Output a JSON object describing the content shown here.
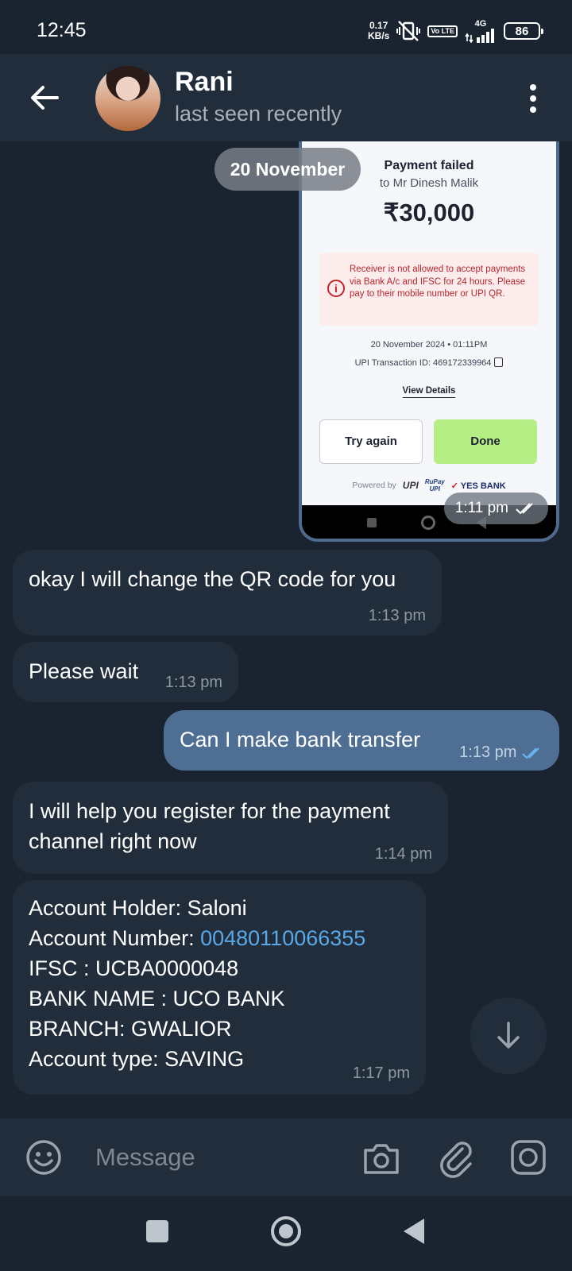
{
  "status_bar": {
    "time": "12:45",
    "net_speed_value": "0.17",
    "net_speed_unit": "KB/s",
    "volte": "Vo LTE",
    "network": "4G",
    "battery": "86"
  },
  "header": {
    "name": "Rani",
    "status": "last seen recently"
  },
  "date_chip": "20 November",
  "payment_screenshot": {
    "title": "Payment failed",
    "to": "to Mr Dinesh Malik",
    "amount": "₹30,000",
    "alert": "Receiver is not allowed to accept payments via Bank A/c and IFSC for 24 hours. Please pay to their mobile number or UPI QR.",
    "alert_icon": "i",
    "date": "20 November 2024 • 01:11PM",
    "txn": "UPI Transaction ID: 469172339964",
    "view_details": "View Details",
    "try_again": "Try again",
    "done": "Done",
    "powered_by": "Powered by",
    "upi": "UPI",
    "rupay_top": "RuPay",
    "rupay_bottom": "UPI",
    "yes_mark": "✓",
    "yes_bank": "YES BANK",
    "time": "1:11 pm"
  },
  "messages": [
    {
      "direction": "in",
      "text": "okay I will change the QR code for you",
      "time": "1:13 pm"
    },
    {
      "direction": "in",
      "text": "Please wait",
      "time": "1:13 pm"
    },
    {
      "direction": "out",
      "text": "Can I make bank transfer",
      "time": "1:13 pm"
    },
    {
      "direction": "in",
      "line1": "I will help you register for the payment",
      "line2": "channel right now",
      "time": "1:14 pm"
    },
    {
      "direction": "in",
      "lines": {
        "holder": "Account Holder: Saloni",
        "number_label": "Account Number: ",
        "number": "00480110066355",
        "ifsc": "IFSC : UCBA0000048",
        "bank": "BANK NAME : UCO BANK",
        "branch": "BRANCH: GWALIOR",
        "type": "Account type: SAVING"
      },
      "time": "1:17 pm"
    }
  ],
  "input": {
    "placeholder": "Message"
  },
  "colors": {
    "background": "#1a2330",
    "header": "#212d3b",
    "outgoing": "#4f6e94",
    "link": "#5aa8e6",
    "done_button": "#b5ee85"
  },
  "icons": [
    "back-arrow-icon",
    "more-vert-icon",
    "emoji-icon",
    "camera-icon",
    "attach-icon",
    "sticker-icon",
    "scroll-down-icon",
    "double-check-icon"
  ]
}
